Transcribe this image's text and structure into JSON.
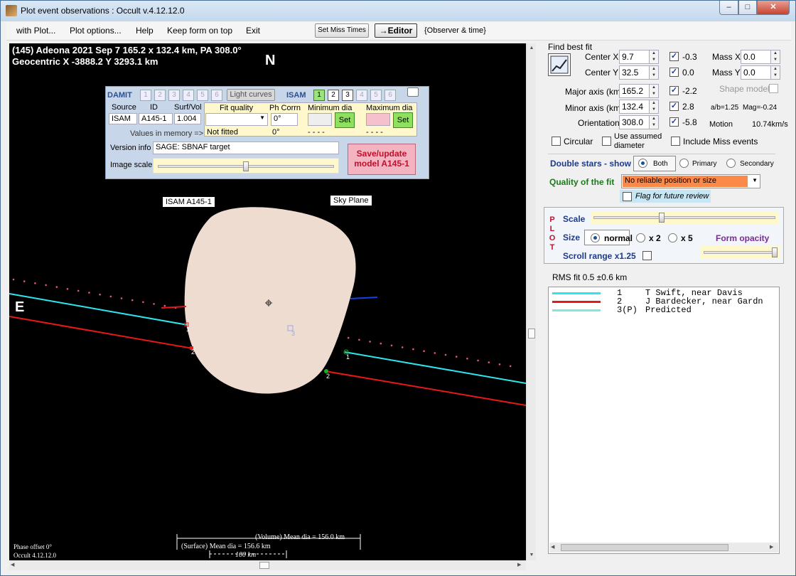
{
  "window": {
    "title": "Plot event observations : Occult v.4.12.12.0",
    "min": "–",
    "max": "□",
    "close": "✕"
  },
  "menu": {
    "with_plot": "with Plot...",
    "plot_options": "Plot options...",
    "help": "Help",
    "keep_on_top": "Keep form on top",
    "exit": "Exit",
    "set_miss_times": "Set Miss Times",
    "editor": "→Editor",
    "observer_time": "{Observer & time}"
  },
  "plot": {
    "header_line1": "(145) Adeona  2021 Sep 7  165.2 x 132.4 km,  PA 308.0°",
    "header_line2": "Geocentric  X -3888.2  Y 3293.1 km",
    "north": "N",
    "east": "E",
    "isam_label": "ISAM A145-1",
    "sky_plane_label": "Sky Plane",
    "phase_offset": "Phase offset 0°",
    "version": "Occult 4.12.12.0",
    "volume_dia": "(Volume) Mean dia = 156.0 km",
    "surface_dia": "(Surface) Mean dia = 156.6 km",
    "scale_bar": "100 km",
    "chord_labels": [
      "1",
      "2",
      "1",
      "2",
      "3"
    ]
  },
  "isam_panel": {
    "damit": "DAMIT",
    "damit_nums": [
      "1",
      "2",
      "3",
      "4",
      "5",
      "6"
    ],
    "light_curves": "Light curves",
    "isam": "ISAM",
    "isam_nums": [
      "1",
      "2",
      "3",
      "4",
      "5",
      "6"
    ],
    "col_source": "Source",
    "col_id": "ID",
    "col_surfvol": "Surf/Vol",
    "source": "ISAM",
    "id": "A145-1",
    "surfvol": "1.004",
    "values_in_memory": "Values in memory =>",
    "fit_quality": "Fit quality",
    "not_fitted": "Not fitted",
    "ph_corrn": "Ph Corrn",
    "ph_corrn_val": "0°",
    "ph_corrn_mem": "0°",
    "min_dia": "Minimum dia",
    "max_dia": "Maximum dia",
    "min_mem": "- - - -",
    "max_mem": "- - - -",
    "set": "Set",
    "version_info_label": "Version info",
    "version_info": "SAGE: SBNAF target",
    "image_scale": "Image scale",
    "save_update": "Save/update model A145-1",
    "image_scale_level": 0.5
  },
  "fit": {
    "find_best_fit": "Find best fit",
    "center_x_label": "Center X",
    "center_x": "9.7",
    "center_x_delta": "-0.3",
    "center_y_label": "Center Y",
    "center_y": "32.5",
    "center_y_delta": "0.0",
    "major_label": "Major axis (km)",
    "major": "165.2",
    "major_delta": "-2.2",
    "minor_label": "Minor axis (km)",
    "minor": "132.4",
    "minor_delta": "2.8",
    "orient_label": "Orientation",
    "orient": "308.0",
    "orient_delta": "-5.8",
    "mass_x_label": "Mass X",
    "mass_x": "0.0",
    "mass_y_label": "Mass Y",
    "mass_y": "0.0",
    "shape_model": "Shape model",
    "ab_ratio": "a/b=1.25",
    "mag": "Mag=-0.24",
    "motion_label": "Motion",
    "motion": "10.74km/s",
    "circular": "Circular",
    "use_assumed": "Use assumed diameter",
    "include_miss": "Include Miss events",
    "double_stars": "Double stars - show",
    "both": "Both",
    "primary": "Primary",
    "secondary": "Secondary",
    "quality_label": "Quality of the fit",
    "quality_value": "No reliable position or size",
    "flag_review": "Flag for future review"
  },
  "plot_opts": {
    "plot_vertical": [
      "P",
      "L",
      "O",
      "T"
    ],
    "scale": "Scale",
    "size": "Size",
    "normal": "normal",
    "x2": "x 2",
    "x5": "x 5",
    "form_opacity": "Form opacity",
    "scroll_range": "Scroll range x1.25",
    "scale_level": 0.37,
    "opacity_level": 1.0
  },
  "rms": "RMS fit 0.5 ±0.6 km",
  "legend": [
    {
      "num": "1",
      "name": "T Swift, near Davis",
      "color": "#2ee6ee"
    },
    {
      "num": "2",
      "name": "J Bardecker, near Gardn",
      "color": "#e81818"
    },
    {
      "num": "3(P)",
      "name": "Predicted",
      "color": "#7de8e0"
    }
  ],
  "colors": {
    "chord1": "#2ee6ee",
    "chord2": "#e81818",
    "predicted": "#e05878",
    "asteroid": "#efdcd0"
  }
}
